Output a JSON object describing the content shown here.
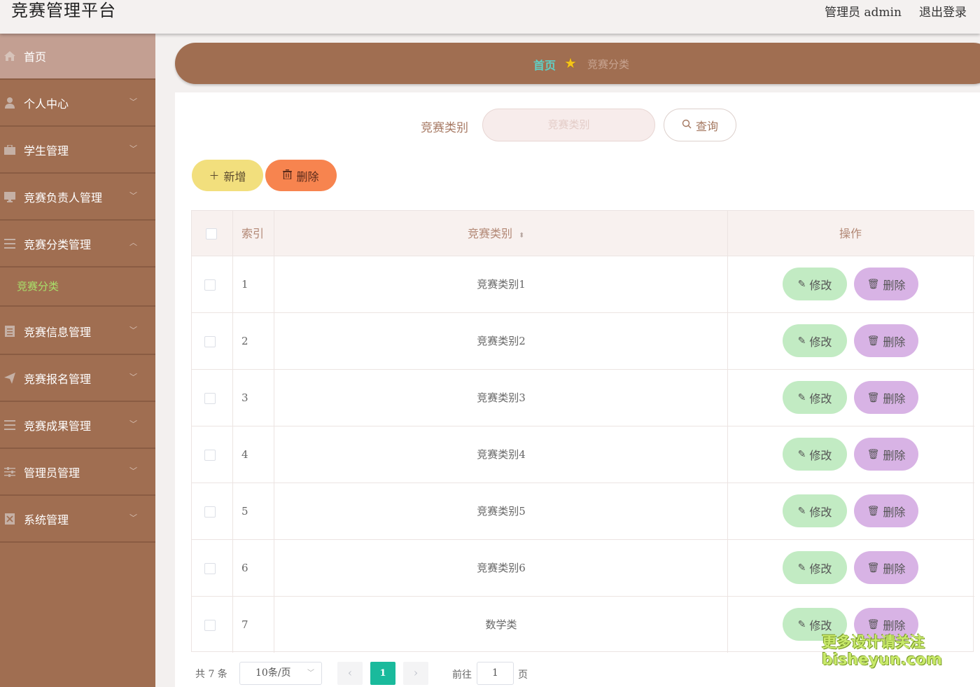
{
  "header": {
    "title": "竞赛管理平台",
    "user": "管理员 admin",
    "logout": "退出登录"
  },
  "sidebar": {
    "items": [
      {
        "label": "首页",
        "icon": "home-icon"
      },
      {
        "label": "个人中心",
        "icon": "user-icon"
      },
      {
        "label": "学生管理",
        "icon": "briefcase-icon"
      },
      {
        "label": "竞赛负责人管理",
        "icon": "monitor-icon"
      },
      {
        "label": "竞赛分类管理",
        "icon": "list-icon"
      },
      {
        "label": "竞赛信息管理",
        "icon": "document-icon"
      },
      {
        "label": "竞赛报名管理",
        "icon": "send-icon"
      },
      {
        "label": "竞赛成果管理",
        "icon": "menu-icon"
      },
      {
        "label": "管理员管理",
        "icon": "sliders-icon"
      },
      {
        "label": "系统管理",
        "icon": "close-box-icon"
      }
    ],
    "submenu": {
      "label": "竞赛分类"
    }
  },
  "breadcrumb": {
    "home": "首页",
    "current": "竞赛分类"
  },
  "search": {
    "label": "竞赛类别",
    "placeholder": "竞赛类别",
    "button": "查询"
  },
  "actions": {
    "add": "新增",
    "delete": "删除"
  },
  "table": {
    "headers": {
      "index": "索引",
      "category": "竞赛类别",
      "operations": "操作"
    },
    "rows": [
      {
        "index": "1",
        "name": "竞赛类别1"
      },
      {
        "index": "2",
        "name": "竞赛类别2"
      },
      {
        "index": "3",
        "name": "竞赛类别3"
      },
      {
        "index": "4",
        "name": "竞赛类别4"
      },
      {
        "index": "5",
        "name": "竞赛类别5"
      },
      {
        "index": "6",
        "name": "竞赛类别6"
      },
      {
        "index": "7",
        "name": "数学类"
      }
    ],
    "edit_label": "修改",
    "delete_label": "删除"
  },
  "pagination": {
    "total": "共 7 条",
    "page_size": "10条/页",
    "current_page": "1",
    "goto_label": "前往",
    "goto_value": "1",
    "page_suffix": "页"
  },
  "watermark": {
    "line1": "更多设计请关注",
    "line2": "bisheyun.com"
  },
  "colors": {
    "accent": "#a06e51",
    "page_active": "#1aba9c",
    "edit_button": "#c2ebc3",
    "row_delete_button": "#d8b3e5",
    "add_button": "#f2df7d",
    "batch_delete_button": "#f7844f"
  }
}
